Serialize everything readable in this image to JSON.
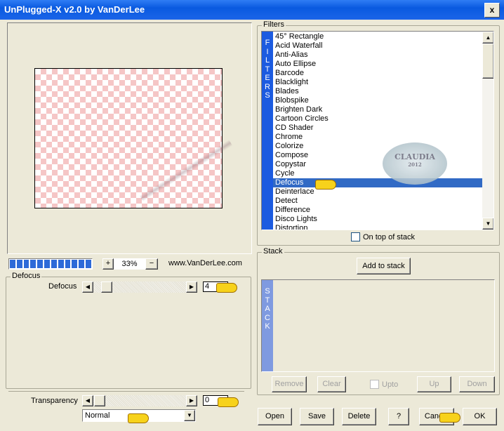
{
  "window": {
    "title": "UnPlugged-X v2.0 by VanDerLee",
    "close_label": "x"
  },
  "preview": {
    "zoom": "33%",
    "plus": "+",
    "minus": "−",
    "website": "www.VanDerLee.com",
    "progress_percent": 100
  },
  "params": {
    "group_label": "Defocus",
    "defocus_label": "Defocus",
    "defocus_value": "4",
    "transparency_label": "Transparency",
    "transparency_value": "0",
    "blend_mode": "Normal"
  },
  "filters": {
    "group_label": "Filters",
    "band": "FILTERS",
    "selected": "Defocus",
    "items": [
      "45° Rectangle",
      "Acid Waterfall",
      "Anti-Alias",
      "Auto Ellipse",
      "Barcode",
      "Blacklight",
      "Blades",
      "Blobspike",
      "Brighten Dark",
      "Cartoon Circles",
      "CD Shader",
      "Chrome",
      "Colorize",
      "Compose",
      "Copystar",
      "Cycle",
      "Defocus",
      "Deinterlace",
      "Detect",
      "Difference",
      "Disco Lights",
      "Distortion"
    ],
    "on_top_label": "On top of stack",
    "watermark": "CLAUDIA",
    "watermark_year": "2012"
  },
  "stack": {
    "group_label": "Stack",
    "band": "STACK",
    "add_label": "Add to stack",
    "remove": "Remove",
    "clear": "Clear",
    "upto": "Upto",
    "up": "Up",
    "down": "Down"
  },
  "footer": {
    "open": "Open",
    "save": "Save",
    "delete": "Delete",
    "help": "?",
    "cancel": "Cancel",
    "ok": "OK"
  },
  "colors": {
    "title_bar": "#0a5ae0",
    "accent": "#1c5be0",
    "selection": "#316ac5"
  }
}
